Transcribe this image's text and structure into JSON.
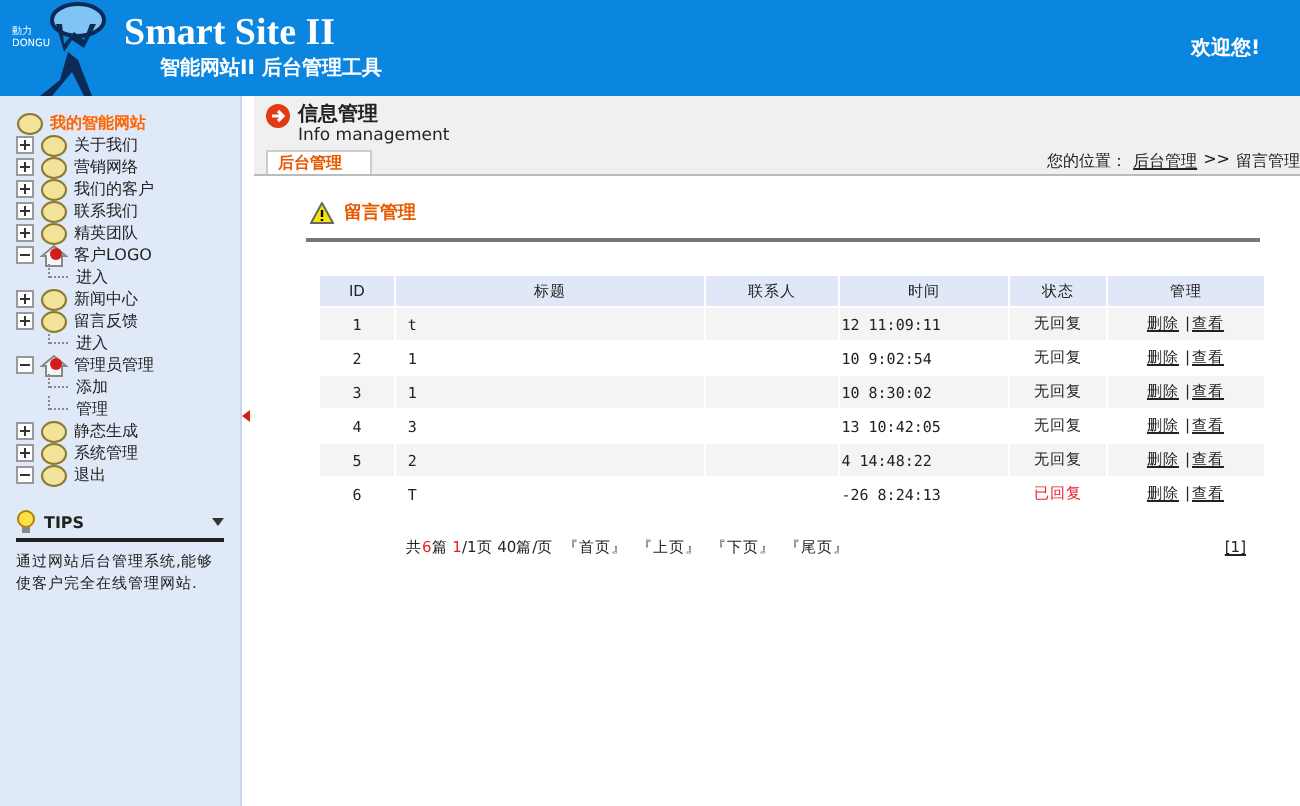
{
  "header": {
    "logo_top": "動力",
    "logo_bottom": "DONGU",
    "title": "Smart Site II",
    "subtitle": "智能网站II 后台管理工具",
    "welcome": "欢迎您!"
  },
  "sidebar": {
    "root": "我的智能网站",
    "items": [
      {
        "label": "关于我们",
        "expanded": false,
        "special": false
      },
      {
        "label": "营销网络",
        "expanded": false,
        "special": false
      },
      {
        "label": "我们的客户",
        "expanded": false,
        "special": false
      },
      {
        "label": "联系我们",
        "expanded": false,
        "special": false
      },
      {
        "label": "精英团队",
        "expanded": false,
        "special": false
      },
      {
        "label": "客户LOGO",
        "expanded": true,
        "special": true,
        "children": [
          {
            "label": "进入"
          }
        ]
      },
      {
        "label": "新闻中心",
        "expanded": false,
        "special": false
      },
      {
        "label": "留言反馈",
        "expanded": false,
        "special": false,
        "children": [
          {
            "label": "进入"
          }
        ]
      },
      {
        "label": "管理员管理",
        "expanded": true,
        "special": true,
        "children": [
          {
            "label": "添加"
          },
          {
            "label": "管理"
          }
        ]
      },
      {
        "label": "静态生成",
        "expanded": false,
        "special": false
      },
      {
        "label": "系统管理",
        "expanded": false,
        "special": false
      },
      {
        "label": "退出",
        "expanded": true,
        "special": false
      }
    ],
    "tips": {
      "title": "TIPS",
      "text": "通过网站后台管理系统,能够使客户完全在线管理网站."
    }
  },
  "page": {
    "title": "信息管理",
    "subtitle": "Info management",
    "tab": "后台管理",
    "location_label": "您的位置：",
    "location_link": "后台管理",
    "location_sep": ">>",
    "location_current": "留言管理",
    "section": "留言管理"
  },
  "table": {
    "columns": [
      "ID",
      "标题",
      "联系人",
      "时间",
      "状态",
      "管理"
    ],
    "rows": [
      {
        "id": "1",
        "title": "t",
        "time": "12 11:09:11",
        "status": "无回复",
        "replied": false,
        "delete": "删除",
        "sep": "|",
        "view": "查看"
      },
      {
        "id": "2",
        "title": "1",
        "time": "10 9:02:54",
        "status": "无回复",
        "replied": false,
        "delete": "删除",
        "sep": "|",
        "view": "查看"
      },
      {
        "id": "3",
        "title": "1",
        "time": "10 8:30:02",
        "status": "无回复",
        "replied": false,
        "delete": "删除",
        "sep": "|",
        "view": "查看"
      },
      {
        "id": "4",
        "title": "3",
        "time": "13 10:42:05",
        "status": "无回复",
        "replied": false,
        "delete": "删除",
        "sep": "|",
        "view": "查看"
      },
      {
        "id": "5",
        "title": "2",
        "time": "4 14:48:22",
        "status": "无回复",
        "replied": false,
        "delete": "删除",
        "sep": "|",
        "view": "查看"
      },
      {
        "id": "6",
        "title": "T",
        "time": "-26 8:24:13",
        "status": "已回复",
        "replied": true,
        "delete": "删除",
        "sep": "|",
        "view": "查看"
      }
    ]
  },
  "pager": {
    "summary": "共**6**篇 **1**/1页 40篇/页",
    "links": [
      "『首页』",
      "『上页』",
      "『下页』",
      "『尾页』"
    ],
    "page": "[1]"
  }
}
